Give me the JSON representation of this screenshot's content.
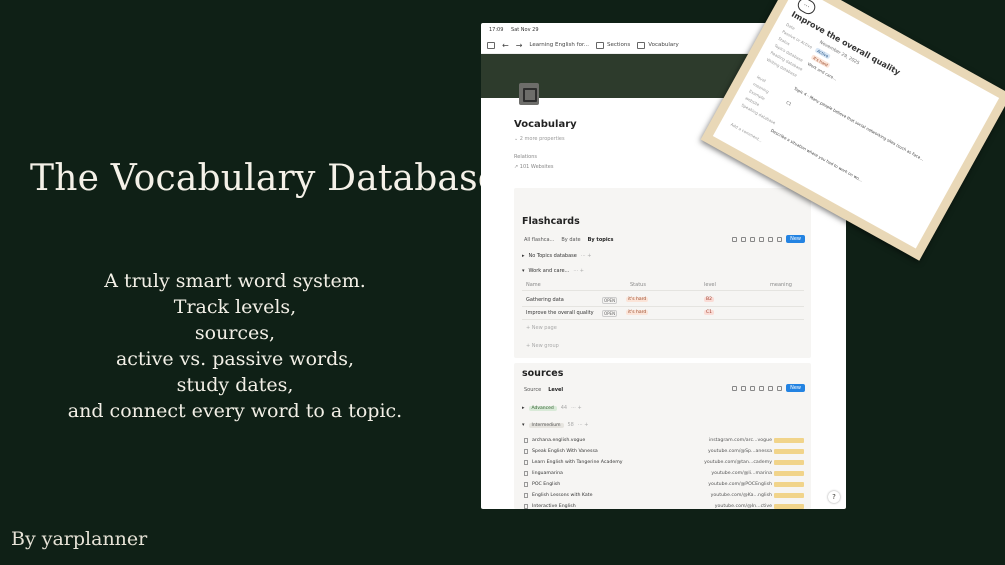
{
  "hero": {
    "title": "The Vocabulary Database",
    "tagline": [
      "A truly smart word system.",
      "Track levels,",
      "sources,",
      "active vs. passive words,",
      "study dates,",
      "and connect every word to a topic."
    ],
    "byline": "By yarplanner"
  },
  "tablet": {
    "status": {
      "time": "17:09",
      "date": "Sat Nov 29"
    },
    "breadcrumb": [
      "Learning English for...",
      "Sections",
      "Vocabulary"
    ],
    "page_title": "Vocabulary",
    "more_properties": "2 more properties",
    "relations_label": "Relations",
    "websites_count": "101 Websites",
    "flashcards": {
      "title": "Flashcards",
      "tabs": [
        "All flashca...",
        "By date",
        "By topics"
      ],
      "new_label": "New",
      "groups": [
        {
          "label": "No Topics database"
        },
        {
          "label": "Work and care..."
        }
      ],
      "columns": [
        "Name",
        "Status",
        "level",
        "meaning"
      ],
      "rows": [
        {
          "name": "Gathering data",
          "open": "OPEN",
          "status": "it's hard",
          "level": "B2"
        },
        {
          "name": "Improve the overall quality",
          "open": "OPEN",
          "status": "it's hard",
          "level": "C1"
        }
      ],
      "new_page": "New page",
      "new_group": "New group"
    },
    "sources": {
      "title": "sources",
      "tabs": [
        "Source",
        "Level"
      ],
      "new_label": "New",
      "advanced": {
        "label": "Advanced",
        "count": "44"
      },
      "intermediate": {
        "label": "Intermedium",
        "count": "58"
      },
      "rows": [
        {
          "name": "archana.english.vogue",
          "url": "instagram.com/arc...vogue"
        },
        {
          "name": "Speak English With Vanessa",
          "url": "youtube.com/@Sp...anessa"
        },
        {
          "name": "Learn English with Tangerine Academy",
          "url": "youtube.com/@tan...cademy"
        },
        {
          "name": "linguamarina",
          "url": "youtube.com/@li...marina"
        },
        {
          "name": "POC English",
          "url": "youtube.com/@POCEnglish"
        },
        {
          "name": "English Lessons with Kate",
          "url": "youtube.com/@Ka...nglish"
        },
        {
          "name": "Interactive English",
          "url": "youtube.com/@In...ctive"
        }
      ]
    }
  },
  "card": {
    "title": "Improve the overall quality",
    "date": "November 29, 2025",
    "props": [
      "Date",
      "Passive or Active",
      "Status",
      "Topics database",
      "Reading database",
      "Writing database",
      "level",
      "meaning",
      "Example",
      "website",
      "Speaking database"
    ],
    "active_tag": "Active",
    "hard_tag": "it's hard",
    "topic_tag": "Work and care...",
    "level_tag": "C1",
    "note1": "Topic 4 - Many people believe that social networking sites (such as Face...",
    "note2": "Describe a situation where you had to work on wo...",
    "add_comment": "Add a comment..."
  }
}
